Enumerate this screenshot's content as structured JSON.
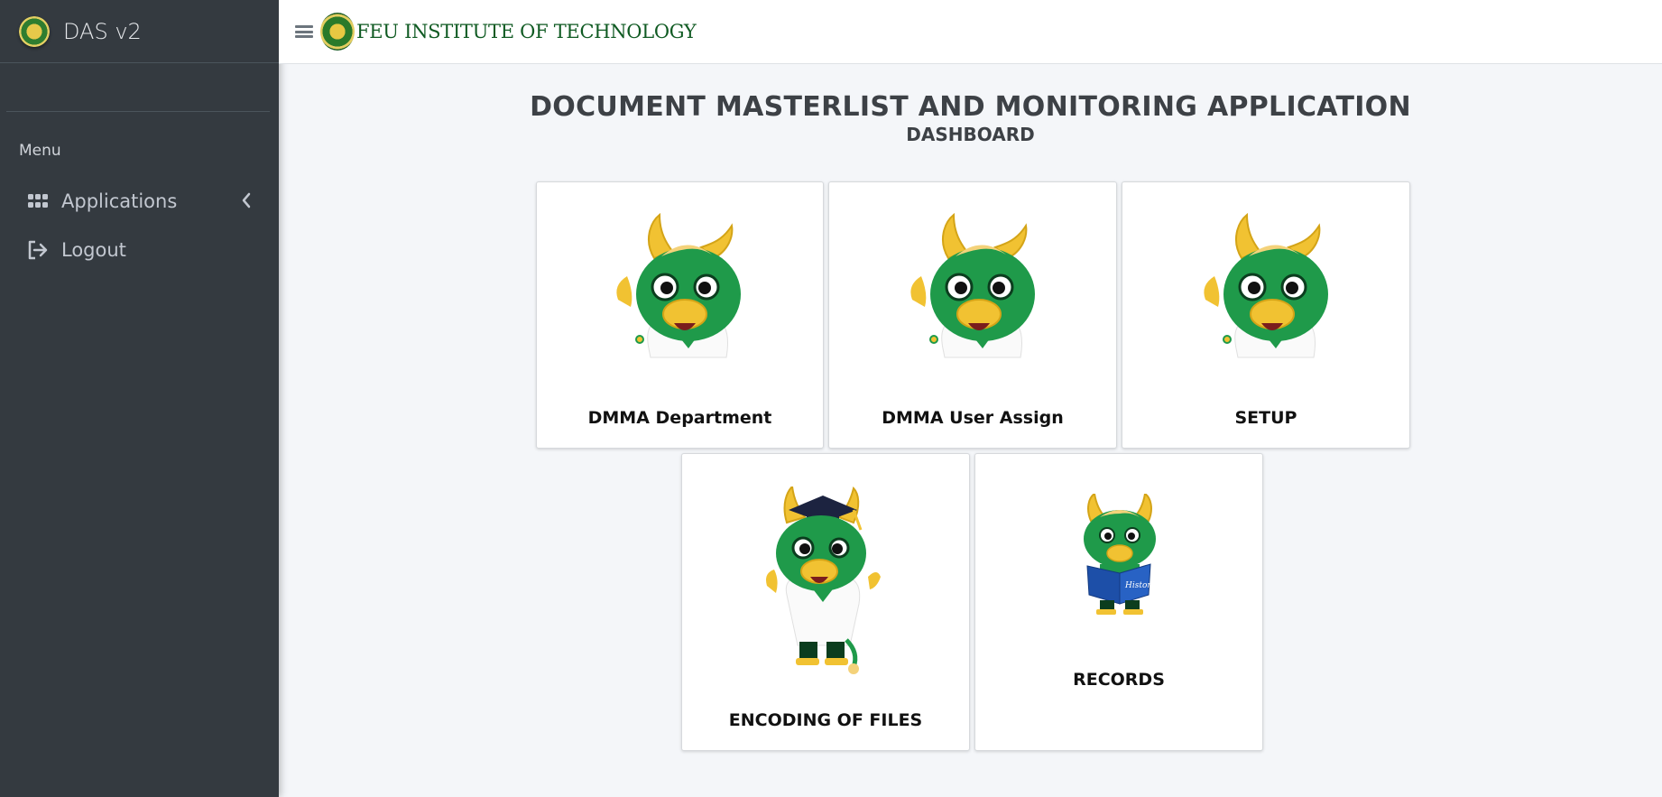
{
  "sidebar": {
    "brand": "DAS v2",
    "menu_header": "Menu",
    "items": [
      {
        "label": "Applications",
        "icon": "apps-grid-icon"
      },
      {
        "label": "Logout",
        "icon": "logout-icon"
      }
    ]
  },
  "topbar": {
    "institution": "FEU INSTITUTE OF TECHNOLOGY"
  },
  "page": {
    "title": "DOCUMENT MASTERLIST AND MONITORING APPLICATION",
    "subtitle": "DASHBOARD"
  },
  "cards": [
    {
      "label": "DMMA Department"
    },
    {
      "label": "DMMA User Assign"
    },
    {
      "label": "SETUP"
    },
    {
      "label": "ENCODING OF FILES"
    },
    {
      "label": "RECORDS"
    }
  ],
  "colors": {
    "sidebar_bg": "#343a40",
    "mascot_green": "#1f9a4a",
    "mascot_gold": "#f1c232",
    "brand_green": "#0f5a22"
  }
}
